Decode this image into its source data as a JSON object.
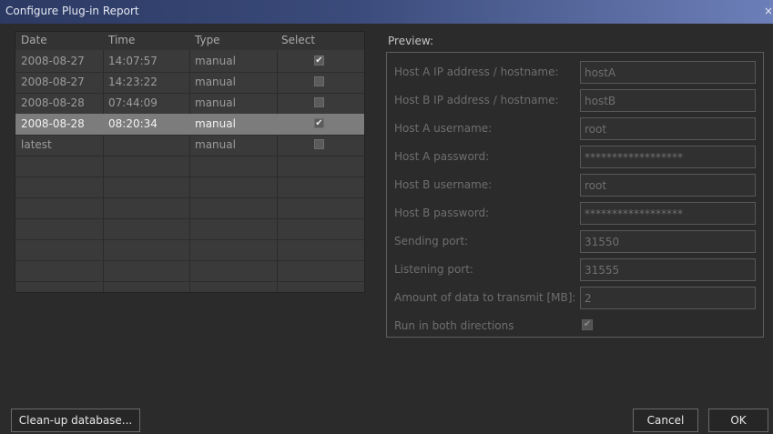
{
  "window": {
    "title": "Configure Plug-in Report",
    "close_glyph": "×"
  },
  "table": {
    "headers": [
      "Date",
      "Time",
      "Type",
      "Select"
    ],
    "rows": [
      {
        "date": "2008-08-27",
        "time": "14:07:57",
        "type": "manual",
        "selected": true,
        "highlight": false
      },
      {
        "date": "2008-08-27",
        "time": "14:23:22",
        "type": "manual",
        "selected": false,
        "highlight": false
      },
      {
        "date": "2008-08-28",
        "time": "07:44:09",
        "type": "manual",
        "selected": false,
        "highlight": false
      },
      {
        "date": "2008-08-28",
        "time": "08:20:34",
        "type": "manual",
        "selected": true,
        "highlight": true
      },
      {
        "date": "latest",
        "time": "",
        "type": "manual",
        "selected": false,
        "highlight": false
      }
    ],
    "check_glyph": "✔"
  },
  "preview": {
    "label": "Preview:",
    "fields": [
      {
        "label": "Host A IP address / hostname:",
        "value": "hostA"
      },
      {
        "label": "Host B IP address / hostname:",
        "value": "hostB"
      },
      {
        "label": "Host A username:",
        "value": "root"
      },
      {
        "label": "Host A password:",
        "value": "******************"
      },
      {
        "label": "Host B username:",
        "value": "root"
      },
      {
        "label": "Host B password:",
        "value": "******************"
      },
      {
        "label": "Sending port:",
        "value": "31550"
      },
      {
        "label": "Listening port:",
        "value": "31555"
      },
      {
        "label": "Amount of data to transmit [MB]:",
        "value": "2"
      }
    ],
    "run_both": {
      "label": "Run in both directions",
      "checked": true
    }
  },
  "buttons": {
    "cleanup": "Clean-up database...",
    "cancel": "Cancel",
    "ok": "OK"
  },
  "colors": {
    "title_gradient_start": "#2c3a63",
    "title_gradient_end": "#6d7fb8",
    "selected_row": "#7c7c7c"
  }
}
